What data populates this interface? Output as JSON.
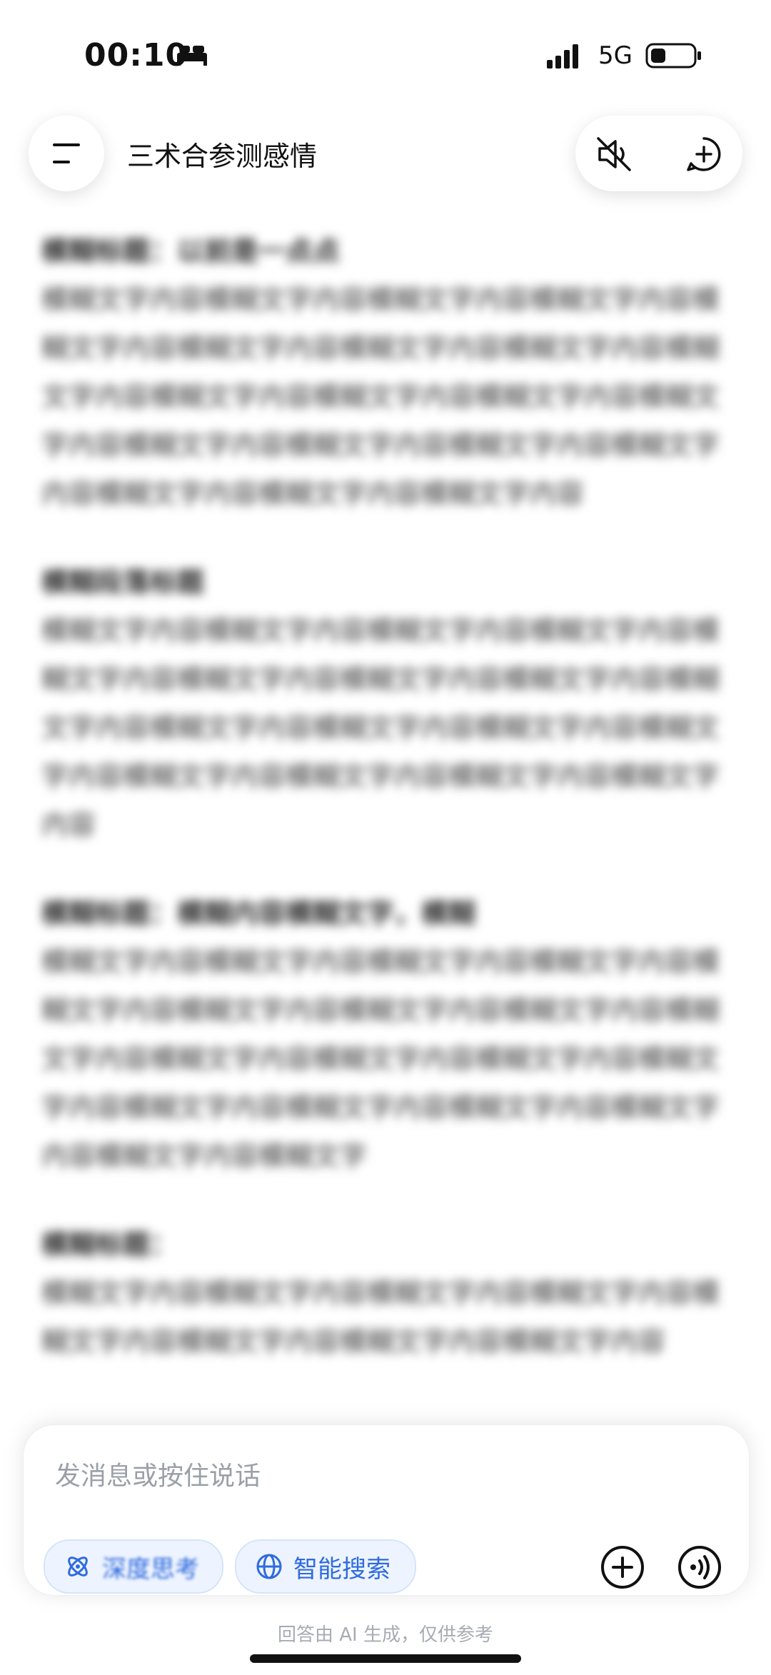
{
  "status_bar": {
    "time": "00:10",
    "network": "5G"
  },
  "header": {
    "title": "三术合参测感情"
  },
  "icons": {
    "menu": "menu-icon",
    "sleep": "bed-icon",
    "signal": "signal-icon",
    "battery": "battery-icon",
    "mute": "speaker-mute-icon",
    "new_chat": "new-chat-icon",
    "deep_think": "atom-icon",
    "web_search": "globe-icon",
    "add": "plus-icon",
    "voice": "voice-icon"
  },
  "content": {
    "sections": [
      {
        "heading": "模糊标题：以前是一点点",
        "body": "模糊文字内容模糊文字内容模糊文字内容模糊文字内容模糊文字内容模糊文字内容模糊文字内容模糊文字内容模糊文字内容模糊文字内容模糊文字内容模糊文字内容模糊文字内容模糊文字内容模糊文字内容模糊文字内容模糊文字内容模糊文字内容模糊文字内容模糊文字内容"
      },
      {
        "heading": "模糊段落标题",
        "body": "模糊文字内容模糊文字内容模糊文字内容模糊文字内容模糊文字内容模糊文字内容模糊文字内容模糊文字内容模糊文字内容模糊文字内容模糊文字内容模糊文字内容模糊文字内容模糊文字内容模糊文字内容模糊文字内容模糊文字内容"
      },
      {
        "heading": "模糊标题：模糊内容模糊文字，模糊",
        "body": "模糊文字内容模糊文字内容模糊文字内容模糊文字内容模糊文字内容模糊文字内容模糊文字内容模糊文字内容模糊文字内容模糊文字内容模糊文字内容模糊文字内容模糊文字内容模糊文字内容模糊文字内容模糊文字内容模糊文字内容模糊文字内容模糊文字"
      },
      {
        "heading": "模糊标题：",
        "body": "模糊文字内容模糊文字内容模糊文字内容模糊文字内容模糊文字内容模糊文字内容模糊文字内容模糊文字内容"
      }
    ]
  },
  "composer": {
    "placeholder": "发消息或按住说话",
    "chip_deep_think": "深度思考",
    "chip_web_search": "智能搜索"
  },
  "footer": {
    "disclaimer": "回答由 AI 生成，仅供参考"
  }
}
